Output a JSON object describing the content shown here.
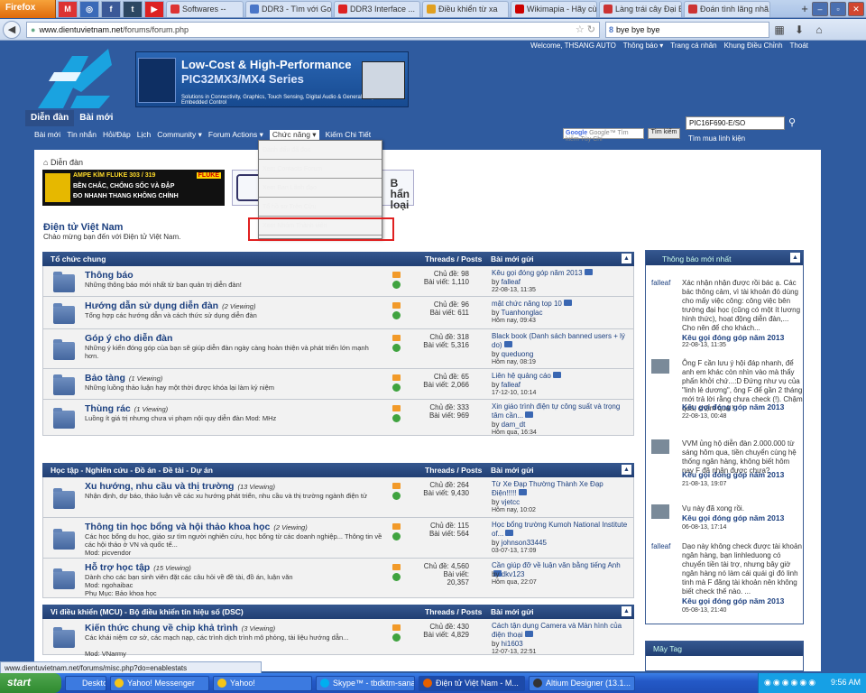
{
  "browser": {
    "menu_label": "Firefox",
    "pinned_tabs": [
      {
        "icon": "gmail-icon",
        "label": "M",
        "color": "#d33"
      },
      {
        "icon": "app-icon",
        "label": "◎",
        "color": "#3a6ab8"
      },
      {
        "icon": "facebook-icon",
        "label": "f",
        "color": "#3b5998"
      },
      {
        "icon": "tumblr-icon",
        "label": "t",
        "color": "#2c4762"
      },
      {
        "icon": "youtube-icon",
        "label": "▶",
        "color": "#d22"
      }
    ],
    "tabs": [
      {
        "label": "Softwares --",
        "color": "#d33"
      },
      {
        "label": "DDR3 - Tìm với Goo...",
        "color": "#4a76c8"
      },
      {
        "label": "DDR3 Interface ...",
        "color": "#d22"
      },
      {
        "label": "Điều khiển từ xa",
        "color": "#e0a020"
      },
      {
        "label": "Wikimapia - Hãy cù...",
        "color": "#c00"
      },
      {
        "label": "Làng trái cây Đại Bình",
        "color": "#c33"
      },
      {
        "label": "Đoán tình lãng nhã...",
        "color": "#c33"
      }
    ],
    "url_domain": "www.dientuvietnam.net",
    "url_path": "/forums/forum.php",
    "search_value": "bye bye bye",
    "status_url": "www.dientuvietnam.net/forums/misc.php?do=enablestats"
  },
  "forum": {
    "top_links": [
      "Welcome, THSANG AUTO",
      "Thông báo ▾",
      "Trang cá nhân",
      "Khung Điều Chỉnh",
      "Thoát"
    ],
    "banner": {
      "line1": "Low-Cost & High-Performance",
      "line2": "PIC32MX3/MX4 Series",
      "line3": "Solutions in Connectivity, Graphics, Touch Sensing, Digital Audio & General Purpose Embedded Control"
    },
    "main_tabs": [
      "Diễn đàn",
      "Bài mới"
    ],
    "subnav": [
      "Bài mới",
      "Tin nhắn",
      "Hỏi/Đáp",
      "Lịch",
      "Community ▾",
      "Forum Actions ▾",
      "Chức năng ▾",
      "Kiếm Chi Tiết"
    ],
    "google_search_placeholder": "Google™ Tìm kiếm Tùy Chỉ",
    "google_search_button": "Tìm kiếm",
    "right_search_value": "PIC16F690-E/SO",
    "advanced_search": "Tìm mua linh kiện",
    "breadcrumb": "Diễn đàn",
    "ad1": {
      "l1": "AMPE KÌM FLUKE 303 / 319",
      "l2": "BỀN CHẮC, CHỐNG SỐC VÀ ĐẬP",
      "l3": "ĐO NHANH THANG KHÔNG CHÍNH",
      "brand": "FLUKE"
    },
    "ad2_text": "B\nhẩn\nloại",
    "site_title": "Điện tử Việt Nam",
    "site_subtitle": "Chào mừng bạn đến với Điện tử Việt Nam."
  },
  "blocks": [
    {
      "name": "Tổ chức chung",
      "threads_posts": "Threads / Posts",
      "last_post": "Bài mới gửi",
      "rows": [
        {
          "title": "Thông báo",
          "viewing": "",
          "desc": "Những thông báo mới nhất từ ban quản trị diễn đàn!",
          "mod": "",
          "sub": "",
          "threads": "Chủ đề: 98",
          "posts": "Bài viết: 1,110",
          "lp_title": "Kêu gọi đóng góp năm 2013",
          "lp_by": "falleaf",
          "lp_date": "22-08-13, 11:35"
        },
        {
          "title": "Hướng dẫn sử dụng diễn đàn",
          "viewing": "(2 Viewing)",
          "desc": "Tổng hợp các hướng dẫn và cách thức sử dụng diễn đàn",
          "mod": "",
          "sub": "",
          "threads": "Chủ đề: 96",
          "posts": "Bài viết: 611",
          "lp_title": "mật chức năng top 10",
          "lp_by": "Tuanhonglac",
          "lp_date": "Hôm nay, 09:43"
        },
        {
          "title": "Góp ý cho diễn đàn",
          "viewing": "",
          "desc": "Những ý kiến đóng góp của bạn sẽ giúp diễn đàn ngày càng hoàn thiện và phát triển lớn mạnh hơn.",
          "mod": "",
          "sub": "",
          "threads": "Chủ đề: 318",
          "posts": "Bài viết: 5,316",
          "lp_title": "Black book (Danh sách banned users + lý do)",
          "lp_by": "queduong",
          "lp_date": "Hôm nay, 08:19"
        },
        {
          "title": "Bảo tàng",
          "viewing": "(1 Viewing)",
          "desc": "Những luồng thảo luận hay một thời được khóa lại làm kỷ niệm",
          "mod": "",
          "sub": "",
          "threads": "Chủ đề: 65",
          "posts": "Bài viết: 2,066",
          "lp_title": "Liên hệ quảng cáo",
          "lp_by": "falleaf",
          "lp_date": "17-12-10, 10:14"
        },
        {
          "title": "Thùng rác",
          "viewing": "(1 Viewing)",
          "desc": "Luồng ít giá trị nhưng chưa vi phạm nội quy diễn đàn Mod: MHz",
          "mod": "",
          "sub": "",
          "threads": "Chủ đề: 333",
          "posts": "Bài viết: 969",
          "lp_title": "Xin giáo trình điện tự công suất và trọng tâm cần...",
          "lp_by": "dam_dt",
          "lp_date": "Hôm qua, 16:34"
        }
      ]
    },
    {
      "name": "Học tập - Nghiên cứu - Đồ án - Đề tài - Dự án",
      "threads_posts": "Threads / Posts",
      "last_post": "Bài mới gửi",
      "rows": [
        {
          "title": "Xu hướng, nhu cầu và thị trường",
          "viewing": "(13 Viewing)",
          "desc": "Nhận định, dự báo, thảo luận về các xu hướng phát triển, nhu cầu và thị trường ngành điện tử",
          "mod": "",
          "sub": "",
          "threads": "Chủ đề: 264",
          "posts": "Bài viết: 9,430",
          "lp_title": "Từ Xe Đạp Thường Thành Xe Đạp Điện!!!!!",
          "lp_by": "vjetcc",
          "lp_date": "Hôm nay, 10:02"
        },
        {
          "title": "Thông tin học bổng và hội thảo khoa học",
          "viewing": "(2 Viewing)",
          "desc": "Các học bổng du học, giáo sư tìm người nghiên cứu, học bổng từ các doanh nghiệp... Thông tin về các hội thảo ở VN và quốc tế...",
          "mod": "Mod: picvendor",
          "sub": "",
          "threads": "Chủ đề: 115",
          "posts": "Bài viết: 564",
          "lp_title": "Học bổng trường Kumoh National Institute of...",
          "lp_by": "johnson33445",
          "lp_date": "03-07-13, 17:09"
        },
        {
          "title": "Hỗ trợ học tập",
          "viewing": "(15 Viewing)",
          "desc": "Dành cho các bạn sinh viên đặt các câu hỏi về đề tài, đồ án, luận văn",
          "mod": "Mod: ngohaibac",
          "sub": "Phụ Mục: Bảo khoa học",
          "threads": "Chủ đề: 4,560",
          "posts": "Bài viết: 20,357",
          "lp_title": "Cần giúp đỡ về luận văn bằng tiếng Anh",
          "lp_by": "dkv123",
          "lp_date": "Hôm qua, 22:07"
        }
      ]
    },
    {
      "name": "Vi điều khiển (MCU) - Bộ điều khiển tín hiệu số (DSC)",
      "threads_posts": "Threads / Posts",
      "last_post": "Bài mới gửi",
      "rows": [
        {
          "title": "Kiến thức chung về chip khả trình",
          "viewing": "(3 Viewing)",
          "desc": "Các khái niệm cơ sở, các mạch nạp, các trình dịch trình mô phỏng, tài liệu hướng dẫn...",
          "mod": "Mod: VNarmy",
          "sub": "",
          "threads": "Chủ đề: 430",
          "posts": "Bài viết: 4,829",
          "lp_title": "Cách tận dụng Camera và Màn hình của điện thoại",
          "lp_by": "hi1603",
          "lp_date": "12-07-13, 22:51"
        }
      ]
    }
  ],
  "dropdown": {
    "items": [
      "Đánh dấu đã đọc",
      "Xem Contacts Forum",
      "Xem Ban Lãnh đạo",
      "Tổ hồ sơ Trên Cửu",
      "Xem Nhóm Thành viên"
    ]
  },
  "sidebar": {
    "title": "Thông báo mới nhất",
    "items": [
      {
        "user": "falleaf",
        "text": "Xác nhận nhận được rồi bác ạ. Các bác thông cảm, vì tài khoản đó dùng cho mấy việc công: công việc bên trường đại học (cũng có một ít lương hình thức), hoạt động diễn đàn,... Cho nên để cho khách...",
        "link": "Kêu gọi đóng góp năm 2013",
        "date": "22-08-13, 11:35"
      },
      {
        "user": "",
        "text": "Ông F cần lưu ý hội đáp nhanh, để anh em khác còn nhìn vào mà thấy phấn khởi chứ...:D Đứng như vụ của \"linh lẻ dương\", ông F để gần 2 tháng mới trả lời rằng chưa check (!). Chậm quá, chậm quá !",
        "link": "Kêu gọi đóng góp năm 2013",
        "date": "22-08-13, 00:48"
      },
      {
        "user": "",
        "text": "VVM ủng hộ diễn đàn 2.000.000 từ sáng hôm qua, tiền chuyển cùng hệ thống ngân hàng, không biết hôm nay F đã nhận được chưa?",
        "link": "Kêu gọi đóng góp năm 2013",
        "date": "21-08-13, 19:07"
      },
      {
        "user": "",
        "text": "Vụ này đã xong rồi.",
        "link": "Kêu gọi đóng góp năm 2013",
        "date": "06-08-13, 17:14"
      },
      {
        "user": "falleaf",
        "text": "Dạo này không check được tài khoản ngân hàng, bạn linhleduong có chuyển tiền tài trợ, nhưng bây giờ ngân hàng nó làm cái quái gì đó linh tinh mà F đăng tài khoản nên không biết check thế nào. ...",
        "link": "Kêu gọi đóng góp năm 2013",
        "date": "05-08-13, 21:40"
      }
    ],
    "tag_title": "Mây Tag"
  },
  "taskbar": {
    "start": "start",
    "items": [
      {
        "label": "Desktop",
        "color": "#3c7ae0",
        "active": false
      },
      {
        "label": "Yahoo! Messenger",
        "color": "#f5c518",
        "active": false
      },
      {
        "label": "Yahoo!",
        "color": "#f5c518",
        "active": false
      },
      {
        "label": "Skype™ - tbdktm-sana",
        "color": "#00aff0",
        "active": false
      },
      {
        "label": "Điện tử Việt Nam - M...",
        "color": "#e66000",
        "active": true
      },
      {
        "label": "Altium Designer (13.1...",
        "color": "#333",
        "active": false
      }
    ],
    "clock": "9:56 AM"
  }
}
